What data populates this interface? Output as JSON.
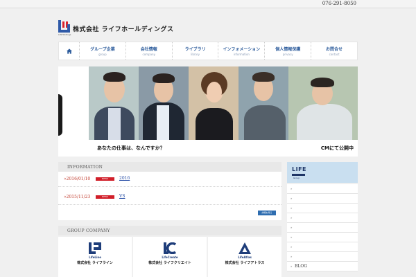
{
  "topbar": {
    "phone": "076-291-8050"
  },
  "header": {
    "company_name": "株式会社 ライフホールディングス",
    "logo_small": "LifeHoldings"
  },
  "nav": {
    "items": [
      {
        "jp": "グループ企業",
        "en": "group"
      },
      {
        "jp": "会社情報",
        "en": "company"
      },
      {
        "jp": "ライブラリ",
        "en": "library"
      },
      {
        "jp": "インフォメーション",
        "en": "information"
      },
      {
        "jp": "個人情報保護",
        "en": "privacy"
      },
      {
        "jp": "お問合せ",
        "en": "contact"
      }
    ]
  },
  "hero": {
    "caption": "あなたの仕事は、なんですか？",
    "cm": "CMにて公開中"
  },
  "info": {
    "heading": "INFORMATION",
    "news": [
      {
        "date": "»2016/01/10",
        "badge": "NEWS",
        "title": "2016"
      },
      {
        "date": "»2015/11/23",
        "badge": "NEWS",
        "title": "VS"
      }
    ],
    "more_label": "詳細を見る"
  },
  "group": {
    "heading": "GROUP COMPANY",
    "companies": [
      {
        "logo_name": "LifeLine",
        "name": "株式会社 ライフライン"
      },
      {
        "logo_name": "LifeCreate",
        "name": "株式会社 ライフクリエイト"
      },
      {
        "logo_name": "LifeAtlas",
        "name": "株式会社 ライフアトラス"
      }
    ]
  },
  "sidebar": {
    "banner": {
      "title": "LIFE",
      "sub": "Group"
    },
    "items": [
      "",
      "",
      "",
      "",
      "",
      "",
      "",
      "",
      "BLOG"
    ]
  },
  "colors": {
    "nav_text": "#2d5c9c",
    "news_date": "#c0392b",
    "badge": "#d11f2a",
    "link": "#2b51a8"
  }
}
